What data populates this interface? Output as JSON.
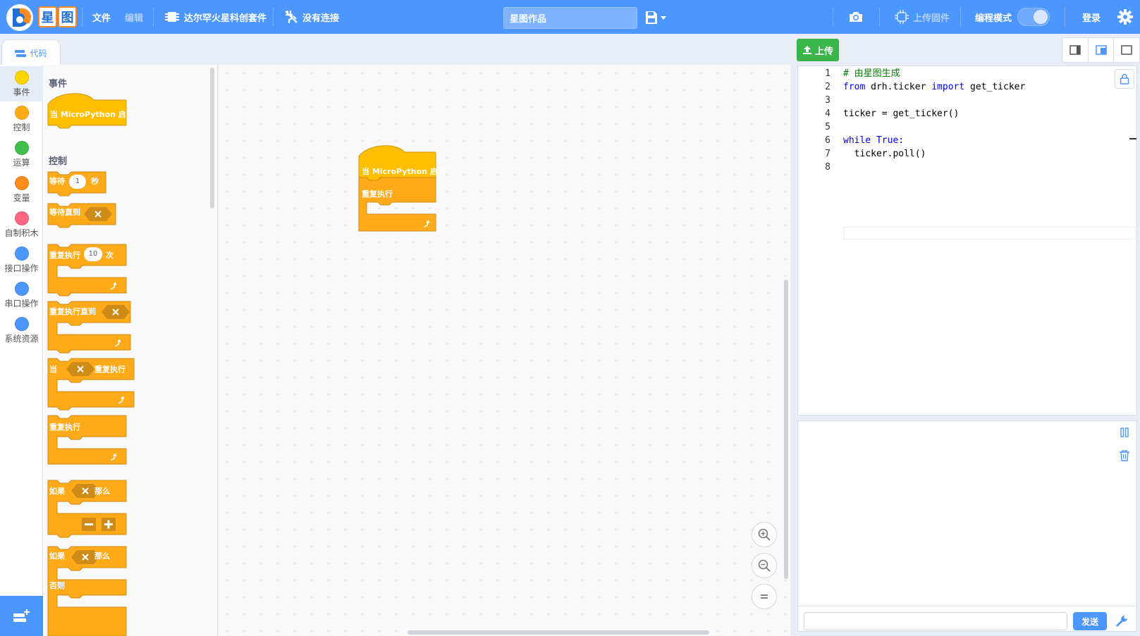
{
  "app": {
    "logo_text": "星图",
    "menu_file": "文件",
    "menu_edit": "编辑",
    "device_name": "达尔罕火星科创套件",
    "connection": "没有连接",
    "project_title": "星图作品",
    "upload_firmware": "上传固件",
    "mode_label": "编程模式",
    "login": "登录"
  },
  "tabs": {
    "code_tab": "代码",
    "upload": "上传"
  },
  "categories": [
    {
      "label": "事件",
      "color": "#ffd500"
    },
    {
      "label": "控制",
      "color": "#ffab19"
    },
    {
      "label": "运算",
      "color": "#40bf4a"
    },
    {
      "label": "变量",
      "color": "#ff8c1a"
    },
    {
      "label": "自制积木",
      "color": "#ff6680"
    },
    {
      "label": "接口操作",
      "color": "#4c97ff"
    },
    {
      "label": "串口操作",
      "color": "#4c97ff"
    },
    {
      "label": "系统资源",
      "color": "#4c97ff"
    }
  ],
  "palette": {
    "events_head": "事件",
    "control_head": "控制",
    "when_start": "当 MicroPython 启动",
    "wait": "等待",
    "wait_value": "1",
    "wait_unit": "秒",
    "wait_until": "等待直到",
    "repeat": "重复执行",
    "repeat_value": "10",
    "repeat_unit": "次",
    "repeat_until": "重复执行直到",
    "while_when": "当",
    "while_repeat": "重复执行",
    "forever": "重复执行",
    "if": "如果",
    "then": "那么",
    "if2": "如果",
    "then2": "那么",
    "else": "否则"
  },
  "workspace": {
    "hat_label": "当 MicroPython 启动",
    "forever_label": "重复执行"
  },
  "code": {
    "lines": [
      {
        "n": "1",
        "text": "# 由星图生成"
      },
      {
        "n": "2",
        "text": "from drh.ticker import get_ticker"
      },
      {
        "n": "3",
        "text": ""
      },
      {
        "n": "4",
        "text": "ticker = get_ticker()"
      },
      {
        "n": "5",
        "text": ""
      },
      {
        "n": "6",
        "text": "while True:"
      },
      {
        "n": "7",
        "text": "  ticker.poll()"
      },
      {
        "n": "8",
        "text": ""
      }
    ]
  },
  "serial": {
    "input_value": "",
    "send_label": "发送"
  },
  "colors": {
    "primary": "#4c97ff",
    "control_block": "#ffab19",
    "control_dark": "#cf8b17",
    "event_block": "#ffbf00",
    "upload_green": "#39b54a"
  }
}
